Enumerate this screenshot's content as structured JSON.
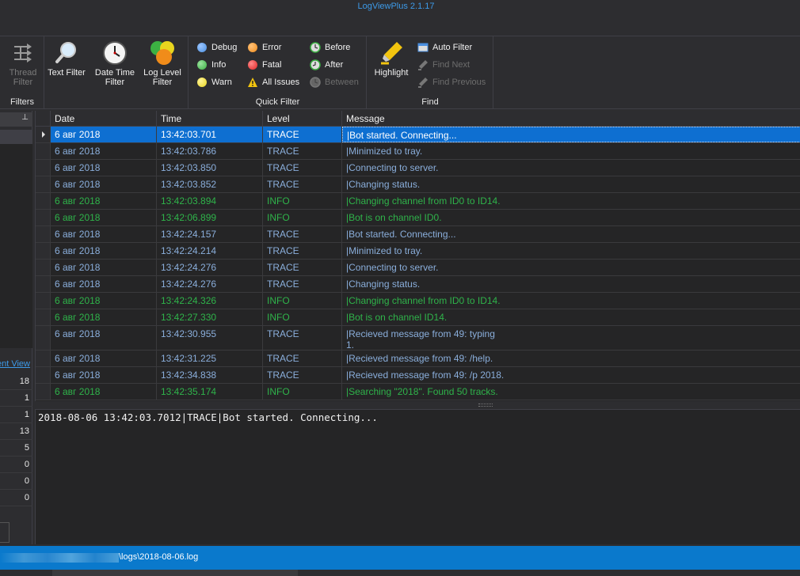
{
  "app": {
    "title": "LogViewPlus 2.1.17"
  },
  "ribbon": {
    "filters": {
      "caption": "Filters",
      "thread_filter": "Thread Filter",
      "text_filter": "Text Filter",
      "date_time_filter": "Date Time Filter",
      "log_level_filter": "Log Level Filter"
    },
    "quick_filter": {
      "caption": "Quick Filter",
      "debug": "Debug",
      "info": "Info",
      "warn": "Warn",
      "error": "Error",
      "fatal": "Fatal",
      "all_issues": "All Issues",
      "before": "Before",
      "after": "After",
      "between": "Between"
    },
    "find": {
      "caption": "Find",
      "highlight": "Highlight",
      "auto_filter": "Auto Filter",
      "find_next": "Find Next",
      "find_previous": "Find Previous"
    }
  },
  "colors": {
    "debug": "#4a8fe0",
    "info": "#3cb043",
    "warn": "#e8d51e",
    "error": "#f08c1a",
    "fatal": "#e02424",
    "selection": "#0e6fd1",
    "statusbar": "#0a79cc"
  },
  "left_panel": {
    "link_text": "ent View",
    "counts": [
      "18",
      "1",
      "1",
      "13",
      "5",
      "0",
      "0",
      "0"
    ]
  },
  "grid": {
    "columns": [
      "Date",
      "Time",
      "Level",
      "Message"
    ],
    "rows": [
      {
        "date": "6 авг 2018",
        "time": "13:42:03.701",
        "level": "TRACE",
        "message": "|Bot started. Connecting..."
      },
      {
        "date": "6 авг 2018",
        "time": "13:42:03.786",
        "level": "TRACE",
        "message": "|Minimized to tray."
      },
      {
        "date": "6 авг 2018",
        "time": "13:42:03.850",
        "level": "TRACE",
        "message": "|Connecting to server."
      },
      {
        "date": "6 авг 2018",
        "time": "13:42:03.852",
        "level": "TRACE",
        "message": "|Changing status."
      },
      {
        "date": "6 авг 2018",
        "time": "13:42:03.894",
        "level": "INFO",
        "message": "|Changing channel from ID0 to ID14."
      },
      {
        "date": "6 авг 2018",
        "time": "13:42:06.899",
        "level": "INFO",
        "message": "|Bot is on channel ID0."
      },
      {
        "date": "6 авг 2018",
        "time": "13:42:24.157",
        "level": "TRACE",
        "message": "|Bot started. Connecting..."
      },
      {
        "date": "6 авг 2018",
        "time": "13:42:24.214",
        "level": "TRACE",
        "message": "|Minimized to tray."
      },
      {
        "date": "6 авг 2018",
        "time": "13:42:24.276",
        "level": "TRACE",
        "message": "|Connecting to server."
      },
      {
        "date": "6 авг 2018",
        "time": "13:42:24.276",
        "level": "TRACE",
        "message": "|Changing status."
      },
      {
        "date": "6 авг 2018",
        "time": "13:42:24.326",
        "level": "INFO",
        "message": "|Changing channel from ID0 to ID14."
      },
      {
        "date": "6 авг 2018",
        "time": "13:42:27.330",
        "level": "INFO",
        "message": "|Bot is on channel ID14."
      },
      {
        "date": "6 авг 2018",
        "time": "13:42:30.955",
        "level": "TRACE",
        "message": "|Recieved message from 49: typing\n1."
      },
      {
        "date": "6 авг 2018",
        "time": "13:42:31.225",
        "level": "TRACE",
        "message": "|Recieved message from 49: /help."
      },
      {
        "date": "6 авг 2018",
        "time": "13:42:34.838",
        "level": "TRACE",
        "message": "|Recieved message from 49: /p 2018."
      },
      {
        "date": "6 авг 2018",
        "time": "13:42:35.174",
        "level": "INFO",
        "message": "|Searching \"2018\". Found 50 tracks."
      }
    ]
  },
  "detail": {
    "text": "2018-08-06 13:42:03.7012|TRACE|Bot started. Connecting..."
  },
  "status": {
    "path": "\\logs\\2018-08-06.log"
  }
}
